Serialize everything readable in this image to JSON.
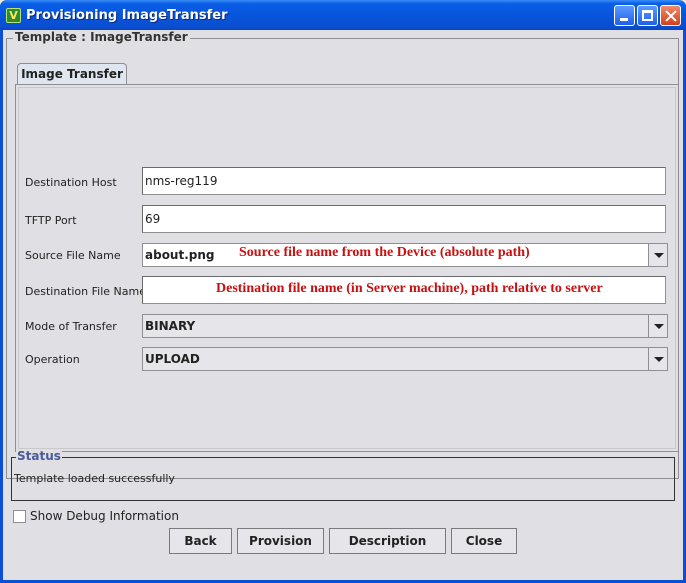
{
  "window": {
    "title": "Provisioning ImageTransfer",
    "icon_letter": "V"
  },
  "template": {
    "legend": "Template : ImageTransfer",
    "tab_label": "Image Transfer"
  },
  "fields": {
    "destination_host": {
      "label": "Destination Host",
      "value": "nms-reg119"
    },
    "tftp_port": {
      "label": "TFTP Port",
      "value": "69"
    },
    "source_file_name": {
      "label": "Source File Name",
      "value": "about.png",
      "annotation": "Source file name from the Device (absolute path)"
    },
    "destination_file_name": {
      "label": "Destination File Name",
      "value": "",
      "annotation": "Destination file name (in Server machine), path relative to server"
    },
    "mode_of_transfer": {
      "label": "Mode of Transfer",
      "value": "BINARY"
    },
    "operation": {
      "label": "Operation",
      "value": "UPLOAD"
    }
  },
  "status": {
    "legend": "Status",
    "text": "Template loaded successfully"
  },
  "debug": {
    "label": "Show Debug Information",
    "checked": false
  },
  "buttons": {
    "back": "Back",
    "provision": "Provision",
    "description": "Description",
    "close": "Close"
  },
  "colors": {
    "titlebar": "#0855dd",
    "annotation": "#c81010",
    "panel": "#e0dfe3",
    "status_legend": "#4a5a9a"
  },
  "icons": [
    "app-icon",
    "minimize-icon",
    "maximize-icon",
    "close-icon",
    "chevron-down-icon"
  ]
}
